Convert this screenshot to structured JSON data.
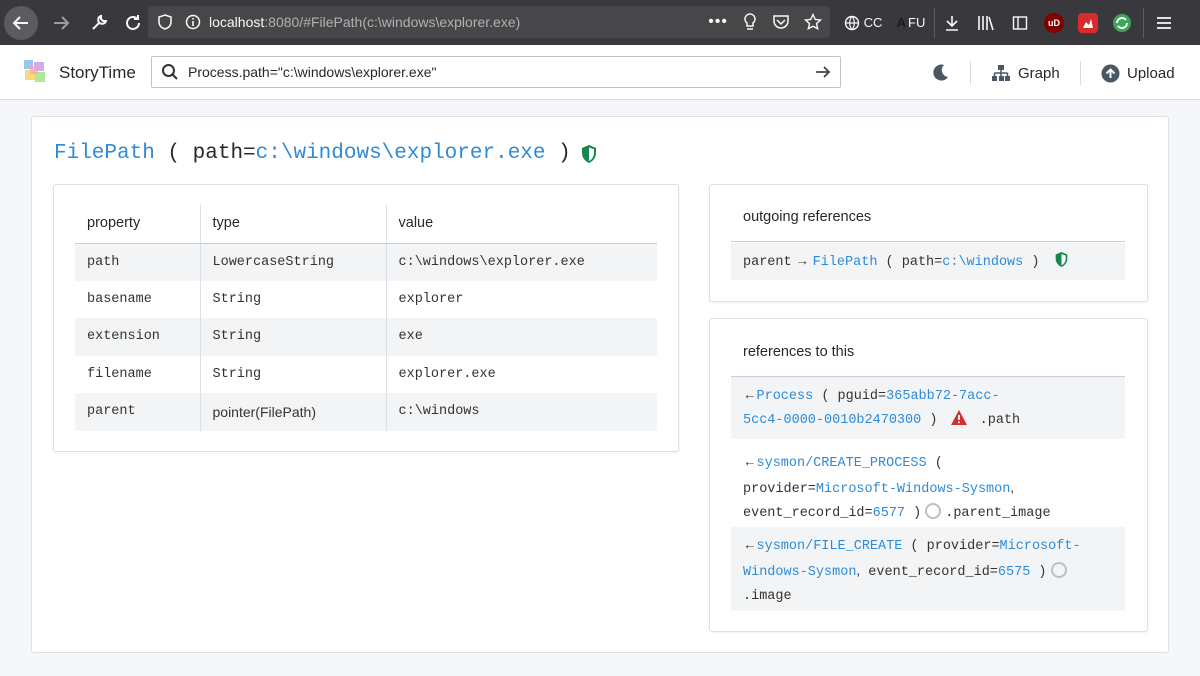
{
  "browser": {
    "url_host": "localhost",
    "url_rest": ":8080/#FilePath(c:\\windows\\explorer.exe)",
    "ext_cc": "CC",
    "ext_fu": "FU",
    "ext_ub": "uD"
  },
  "app": {
    "name": "StoryTime",
    "search_query": "Process.path=\"c:\\windows\\explorer.exe\"",
    "graph_label": "Graph",
    "upload_label": "Upload"
  },
  "entity": {
    "type": "FilePath",
    "open": " ( path=",
    "path": "c:\\windows\\explorer.exe",
    "close": " )"
  },
  "properties": {
    "headers": [
      "property",
      "type",
      "value"
    ],
    "rows": [
      {
        "property": "path",
        "type": "LowercaseString",
        "value": "c:\\windows\\explorer.exe"
      },
      {
        "property": "basename",
        "type": "String",
        "value": "explorer"
      },
      {
        "property": "extension",
        "type": "String",
        "value": "exe"
      },
      {
        "property": "filename",
        "type": "String",
        "value": "explorer.exe"
      },
      {
        "property": "parent",
        "type": "pointer(FilePath)",
        "value": "c:\\windows"
      }
    ]
  },
  "outgoing": {
    "heading": "outgoing references",
    "ref": {
      "field": "parent",
      "arrow": " → ",
      "type": "FilePath",
      "open": " ( path=",
      "value": "c:\\windows",
      "close": " )"
    }
  },
  "incoming": {
    "heading": "references to this",
    "refs": [
      {
        "arrow": "←",
        "type": "Process",
        "open": " ( pguid=",
        "value_line1": "365abb72-7acc-",
        "value_line2": "5cc4-0000-0010b2470300",
        "close": " )",
        "field": ".path"
      },
      {
        "arrow": "←",
        "type": "sysmon/CREATE_PROCESS",
        "open": " (",
        "k1": "provider=",
        "v1": "Microsoft-Windows-Sysmon",
        "sep": ",",
        "k2": "event_record_id=",
        "v2": "6577",
        "close": " )",
        "field": ".parent_image"
      },
      {
        "arrow": "←",
        "type": "sysmon/FILE_CREATE",
        "open": " ( provider=",
        "v1a": "Microsoft-",
        "v1b": "Windows-Sysmon",
        "sep": ",",
        "k2": " event_record_id=",
        "v2": "6575",
        "close": " )",
        "field": ".image"
      }
    ]
  },
  "colors": {
    "link": "#2f8bd6",
    "shield": "#16884a",
    "warning": "#d0302e"
  }
}
